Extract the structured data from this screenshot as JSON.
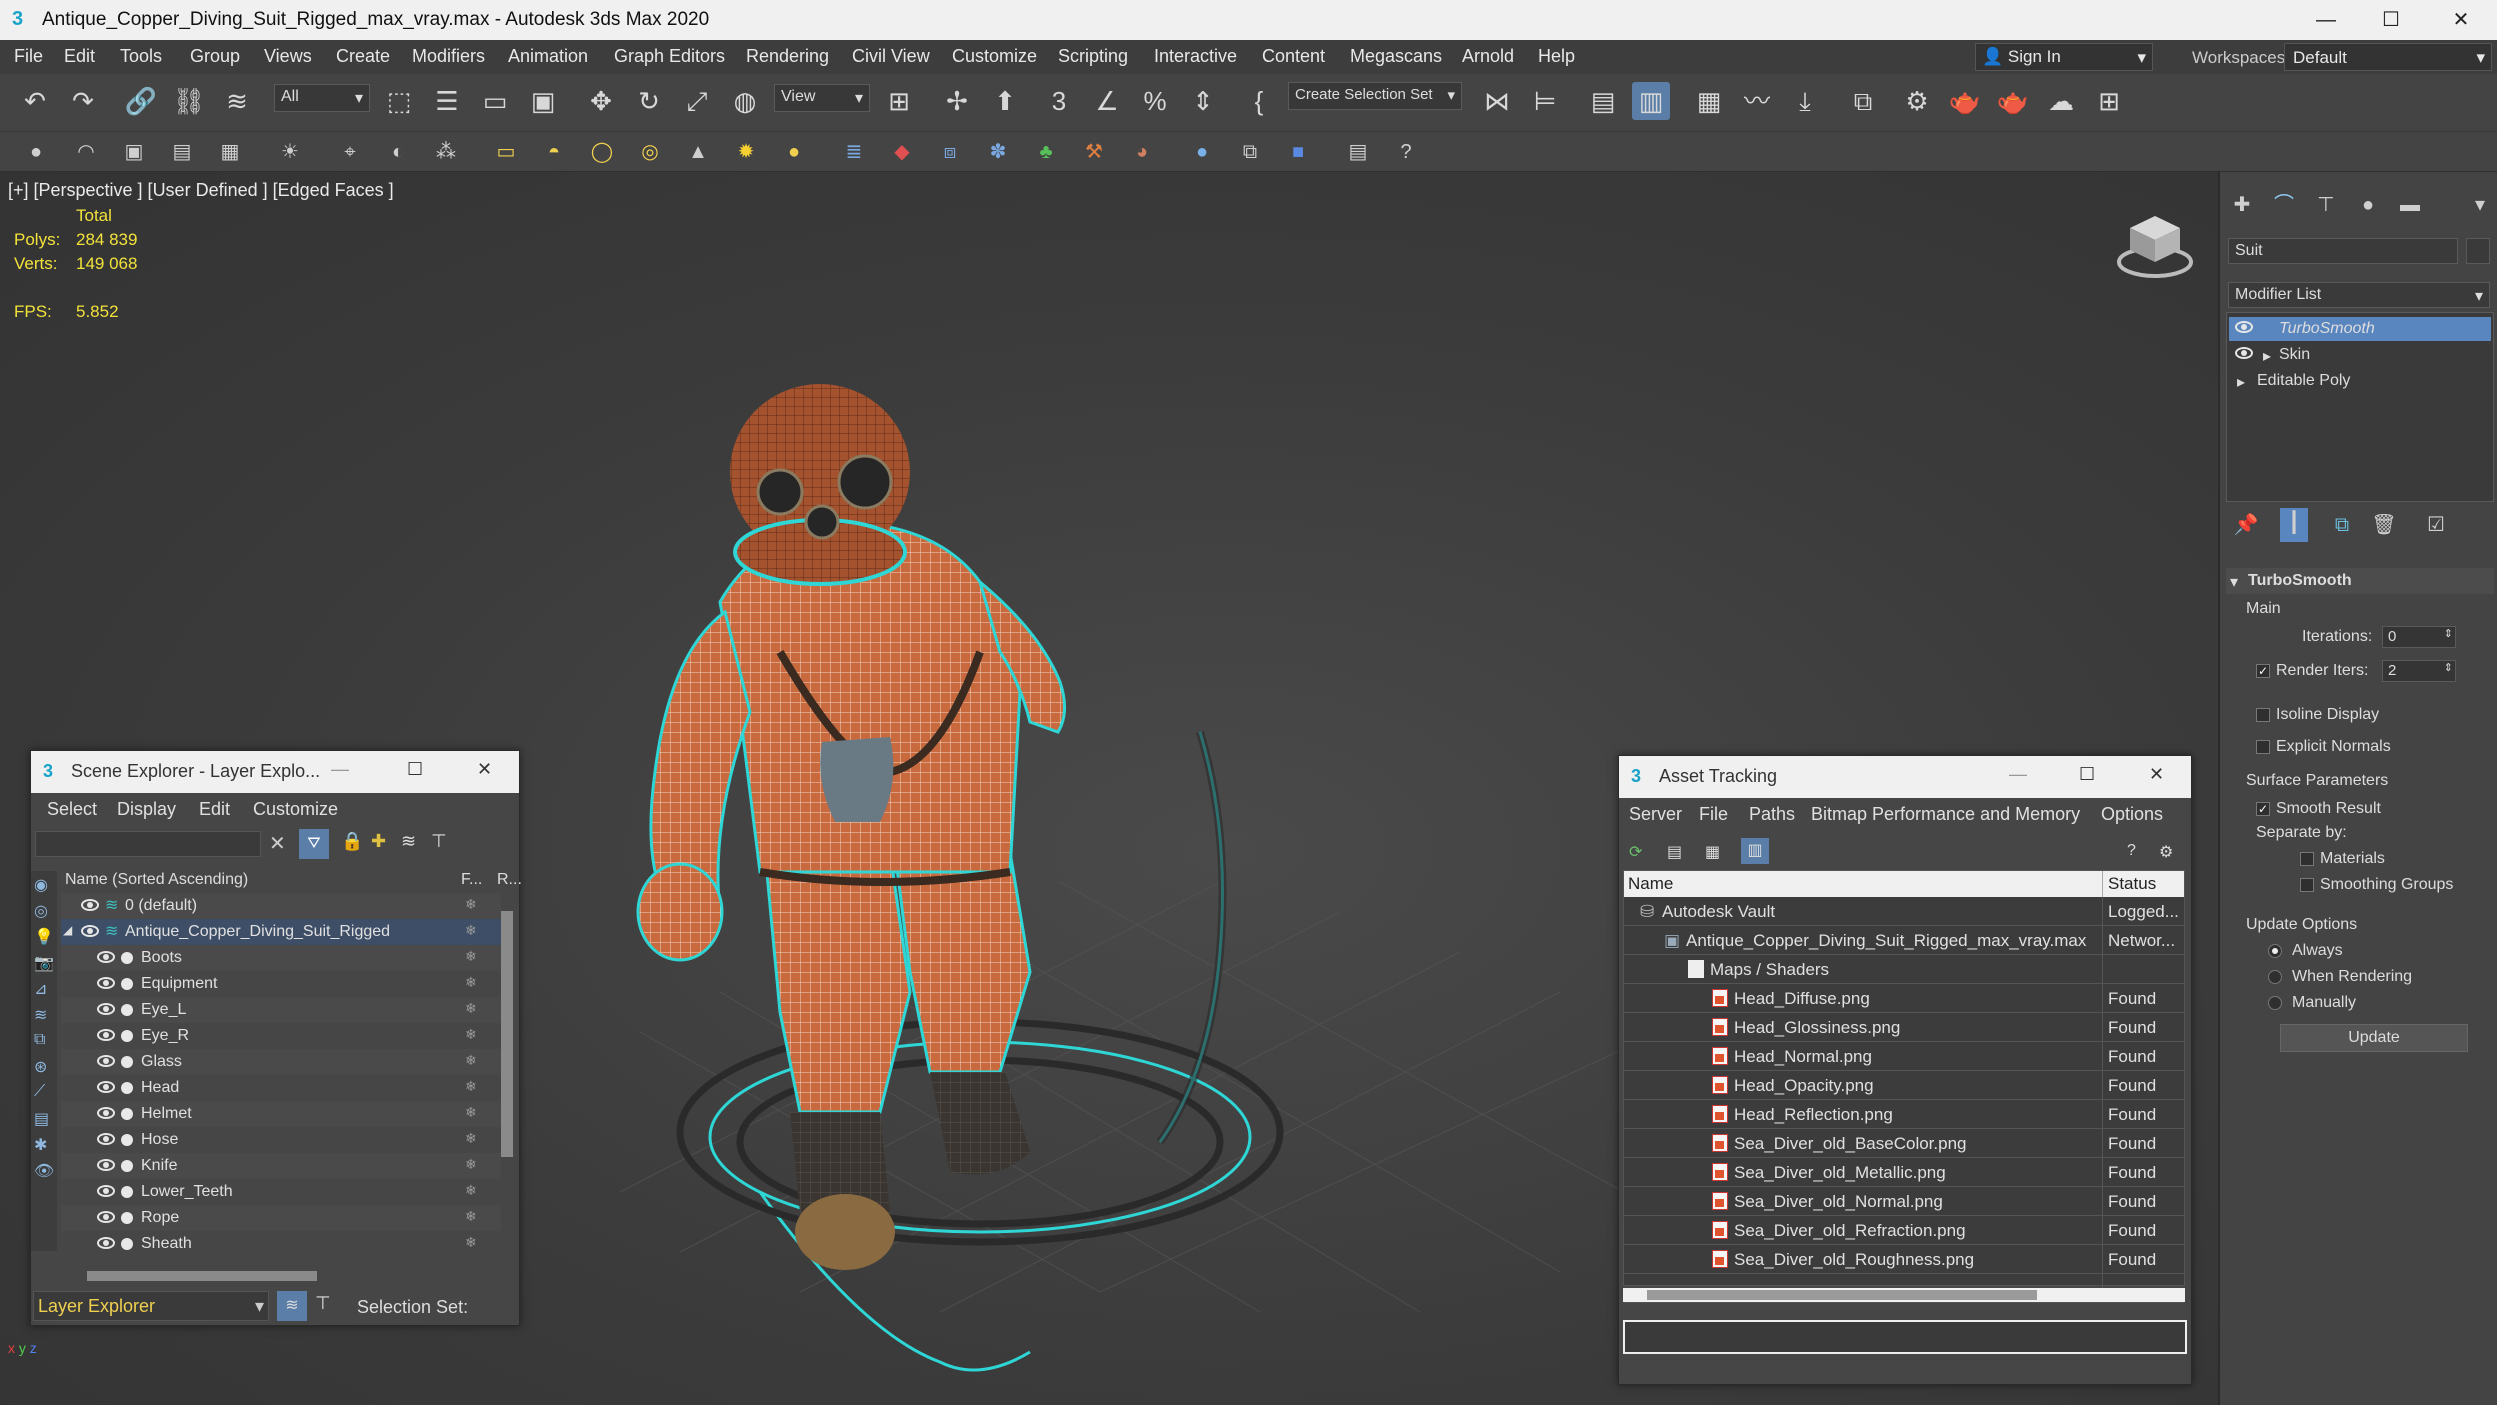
{
  "window": {
    "title": "Antique_Copper_Diving_Suit_Rigged_max_vray.max - Autodesk 3ds Max 2020",
    "minimize": "—",
    "maximize": "☐",
    "close": "✕"
  },
  "menubar": {
    "items": [
      "File",
      "Edit",
      "Tools",
      "Group",
      "Views",
      "Create",
      "Modifiers",
      "Animation",
      "Graph Editors",
      "Rendering",
      "Civil View",
      "Customize",
      "Scripting",
      "Interactive",
      "Content",
      "Megascans",
      "Arnold",
      "Help"
    ],
    "sign_in": "Sign In",
    "workspaces_label": "Workspaces:",
    "workspaces_value": "Default"
  },
  "toolbar": {
    "filter_value": "All",
    "refcoord_value": "View",
    "selection_set_placeholder": "Create Selection Set"
  },
  "viewport": {
    "label": "[+] [Perspective ] [User Defined ] [Edged Faces ]",
    "stats": {
      "total_label": "Total",
      "polys_label": "Polys:",
      "polys_value": "284 839",
      "verts_label": "Verts:",
      "verts_value": "149 068",
      "fps_label": "FPS:",
      "fps_value": "5.852"
    },
    "axis": {
      "x": "x",
      "y": "y",
      "z": "z"
    }
  },
  "command_panel": {
    "object_name": "Suit",
    "modifier_list_label": "Modifier List",
    "stack": [
      {
        "label": "TurboSmooth",
        "selected": true,
        "eye": true,
        "arrow": false
      },
      {
        "label": "Skin",
        "selected": false,
        "eye": true,
        "arrow": true
      },
      {
        "label": "Editable Poly",
        "selected": false,
        "eye": false,
        "arrow": true
      }
    ],
    "rollout_title": "TurboSmooth",
    "main_label": "Main",
    "iterations_label": "Iterations:",
    "iterations_value": "0",
    "render_iters_label": "Render Iters:",
    "render_iters_value": "2",
    "isoline_label": "Isoline Display",
    "explicit_normals_label": "Explicit Normals",
    "surface_params_label": "Surface Parameters",
    "smooth_result_label": "Smooth Result",
    "separate_by_label": "Separate by:",
    "materials_label": "Materials",
    "smoothing_groups_label": "Smoothing Groups",
    "update_options_label": "Update Options",
    "always_label": "Always",
    "when_rendering_label": "When Rendering",
    "manually_label": "Manually",
    "update_button": "Update"
  },
  "scene_explorer": {
    "title": "Scene Explorer - Layer Explo...",
    "menu": [
      "Select",
      "Display",
      "Edit",
      "Customize"
    ],
    "col_name": "Name (Sorted Ascending)",
    "col_f": "F...",
    "col_r": "R...",
    "rows": [
      {
        "label": "0 (default)",
        "level": 0,
        "type": "layer"
      },
      {
        "label": "Antique_Copper_Diving_Suit_Rigged",
        "level": 0,
        "type": "layer-expanded"
      },
      {
        "label": "Boots",
        "level": 1,
        "type": "object"
      },
      {
        "label": "Equipment",
        "level": 1,
        "type": "object"
      },
      {
        "label": "Eye_L",
        "level": 1,
        "type": "object"
      },
      {
        "label": "Eye_R",
        "level": 1,
        "type": "object"
      },
      {
        "label": "Glass",
        "level": 1,
        "type": "object"
      },
      {
        "label": "Head",
        "level": 1,
        "type": "object"
      },
      {
        "label": "Helmet",
        "level": 1,
        "type": "object"
      },
      {
        "label": "Hose",
        "level": 1,
        "type": "object"
      },
      {
        "label": "Knife",
        "level": 1,
        "type": "object"
      },
      {
        "label": "Lower_Teeth",
        "level": 1,
        "type": "object"
      },
      {
        "label": "Rope",
        "level": 1,
        "type": "object"
      },
      {
        "label": "Sheath",
        "level": 1,
        "type": "object"
      }
    ],
    "footer_dropdown": "Layer Explorer",
    "selection_set_label": "Selection Set:"
  },
  "asset_tracking": {
    "title": "Asset Tracking",
    "menu": [
      "Server",
      "File",
      "Paths",
      "Bitmap Performance and Memory",
      "Options"
    ],
    "col_name": "Name",
    "col_status": "Status",
    "rows": [
      {
        "name": "Autodesk Vault",
        "status": "Logged...",
        "level": 0,
        "icon": "vault"
      },
      {
        "name": "Antique_Copper_Diving_Suit_Rigged_max_vray.max",
        "status": "Networ...",
        "level": 1,
        "icon": "max"
      },
      {
        "name": "Maps / Shaders",
        "status": "",
        "level": 2,
        "icon": "folder"
      },
      {
        "name": "Head_Diffuse.png",
        "status": "Found",
        "level": 3,
        "icon": "png"
      },
      {
        "name": "Head_Glossiness.png",
        "status": "Found",
        "level": 3,
        "icon": "png"
      },
      {
        "name": "Head_Normal.png",
        "status": "Found",
        "level": 3,
        "icon": "png"
      },
      {
        "name": "Head_Opacity.png",
        "status": "Found",
        "level": 3,
        "icon": "png"
      },
      {
        "name": "Head_Reflection.png",
        "status": "Found",
        "level": 3,
        "icon": "png"
      },
      {
        "name": "Sea_Diver_old_BaseColor.png",
        "status": "Found",
        "level": 3,
        "icon": "png"
      },
      {
        "name": "Sea_Diver_old_Metallic.png",
        "status": "Found",
        "level": 3,
        "icon": "png"
      },
      {
        "name": "Sea_Diver_old_Normal.png",
        "status": "Found",
        "level": 3,
        "icon": "png"
      },
      {
        "name": "Sea_Diver_old_Refraction.png",
        "status": "Found",
        "level": 3,
        "icon": "png"
      },
      {
        "name": "Sea_Diver_old_Roughness.png",
        "status": "Found",
        "level": 3,
        "icon": "png"
      }
    ]
  },
  "colors": {
    "selection_highlight": "#3b6ea8",
    "stats_yellow": "#f2e23a",
    "wire_cyan": "#2fd6d6",
    "suit_orange": "#c86a3e"
  }
}
